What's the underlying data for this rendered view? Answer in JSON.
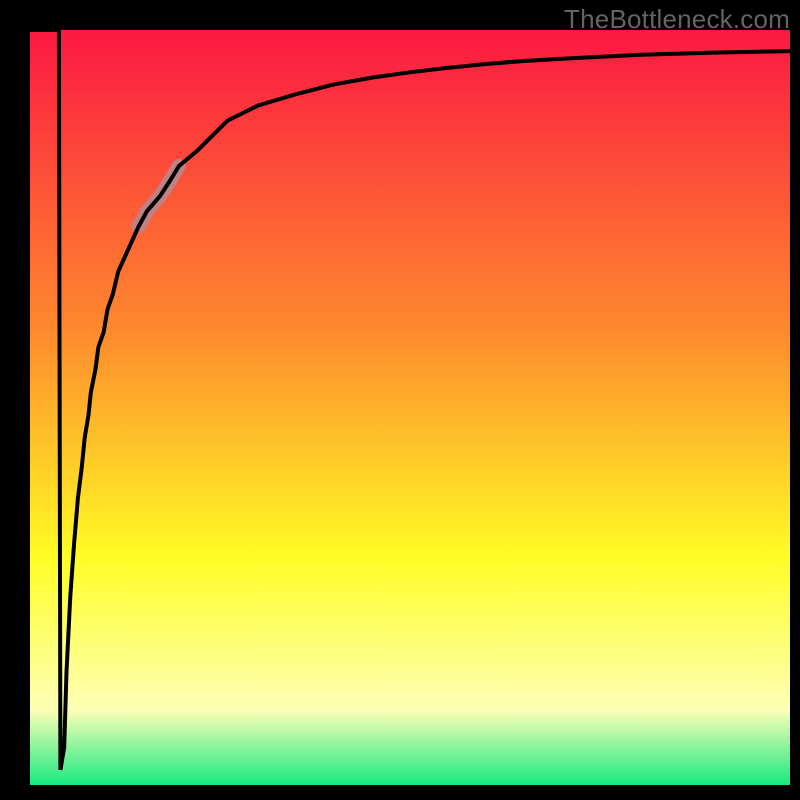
{
  "watermark": "TheBottleneck.com",
  "colors": {
    "frame": "#000000",
    "grad_top": "#fb1842",
    "grad_mid1": "#fe8a2d",
    "grad_mid2": "#fffd25",
    "grad_mid3": "#feffb6",
    "grad_bottom": "#18e981",
    "curve": "#000000",
    "highlight": "#bf8183"
  },
  "chart_data": {
    "type": "line",
    "title": "",
    "xlabel": "",
    "ylabel": "",
    "xlim": [
      0,
      100
    ],
    "ylim": [
      0,
      100
    ],
    "grid": false,
    "series": [
      {
        "name": "bottleneck-curve",
        "x": [
          0,
          3.8,
          4.0,
          4.5,
          4.8,
          5.3,
          5.8,
          6.3,
          6.8,
          7.2,
          7.7,
          8.0,
          8.6,
          9.0,
          9.7,
          10.2,
          10.9,
          11.6,
          12.5,
          13.4,
          14.3,
          15.4,
          17.1,
          18.4,
          19.6,
          22.0,
          24.0,
          26.0,
          30.0,
          35.0,
          40.0,
          45.0,
          50.0,
          55.0,
          60.0,
          65.0,
          70.0,
          80.0,
          90.0,
          100.0
        ],
        "y": [
          100,
          100,
          2,
          5,
          15,
          25,
          32,
          38,
          42,
          46,
          49,
          52,
          55,
          58,
          60,
          63,
          65,
          68,
          70,
          72,
          74,
          76,
          78,
          80,
          82,
          84,
          86,
          88,
          90,
          91.5,
          92.8,
          93.7,
          94.4,
          95.0,
          95.5,
          95.9,
          96.2,
          96.7,
          97.0,
          97.2
        ]
      }
    ],
    "annotations": [
      {
        "name": "highlight-segment",
        "x_range": [
          14.3,
          19.6
        ],
        "description": "thick muted-rose overlay on ascending curve"
      }
    ]
  }
}
